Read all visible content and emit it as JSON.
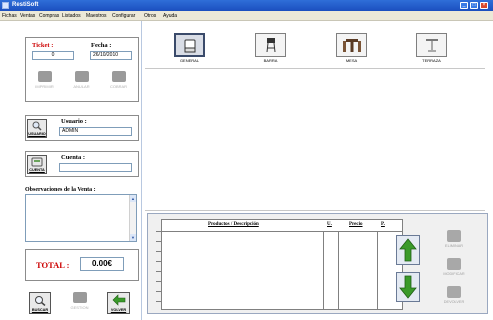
{
  "window": {
    "title": "RestiSoft"
  },
  "menu": [
    "Fichas",
    "Ventas",
    "Compras",
    "Listados",
    "Maestros",
    "Configurar",
    "Otros",
    "Ayuda"
  ],
  "ticket": {
    "label": "Ticket :",
    "value": "0",
    "fecha_label": "Fecha :",
    "fecha_value": "26/10/2010"
  },
  "ticket_actions": [
    "IMPRIMIR",
    "ANULAR",
    "COBRAR"
  ],
  "usuario": {
    "label": "Usuario :",
    "value": "ADMIN",
    "button_caption": "USUARIO"
  },
  "cuenta": {
    "label": "Cuenta :",
    "value": "",
    "button_caption": "CUENTA"
  },
  "observaciones": {
    "label": "Observaciones de la Venta :"
  },
  "total": {
    "label": "TOTAL :",
    "value": "0.00€"
  },
  "bottom_buttons": {
    "buscar": "BUSCAR",
    "gestion": "GESTION",
    "volver": "VOLVER"
  },
  "categories": [
    "GENERAL",
    "BARRA",
    "MESA",
    "TERRAZA"
  ],
  "active_category": "GENERAL",
  "products_table": {
    "headers": [
      "Productos / Descripción",
      "U.",
      "Precio",
      "P."
    ],
    "rows": []
  },
  "line_actions": [
    "ELIMINAR",
    "MODIFICAR",
    "DEVOLVER"
  ],
  "colors": {
    "titlebar": "#1b4fbf",
    "total_red": "#cc0000",
    "arrow_green": "#3a9a2a"
  }
}
